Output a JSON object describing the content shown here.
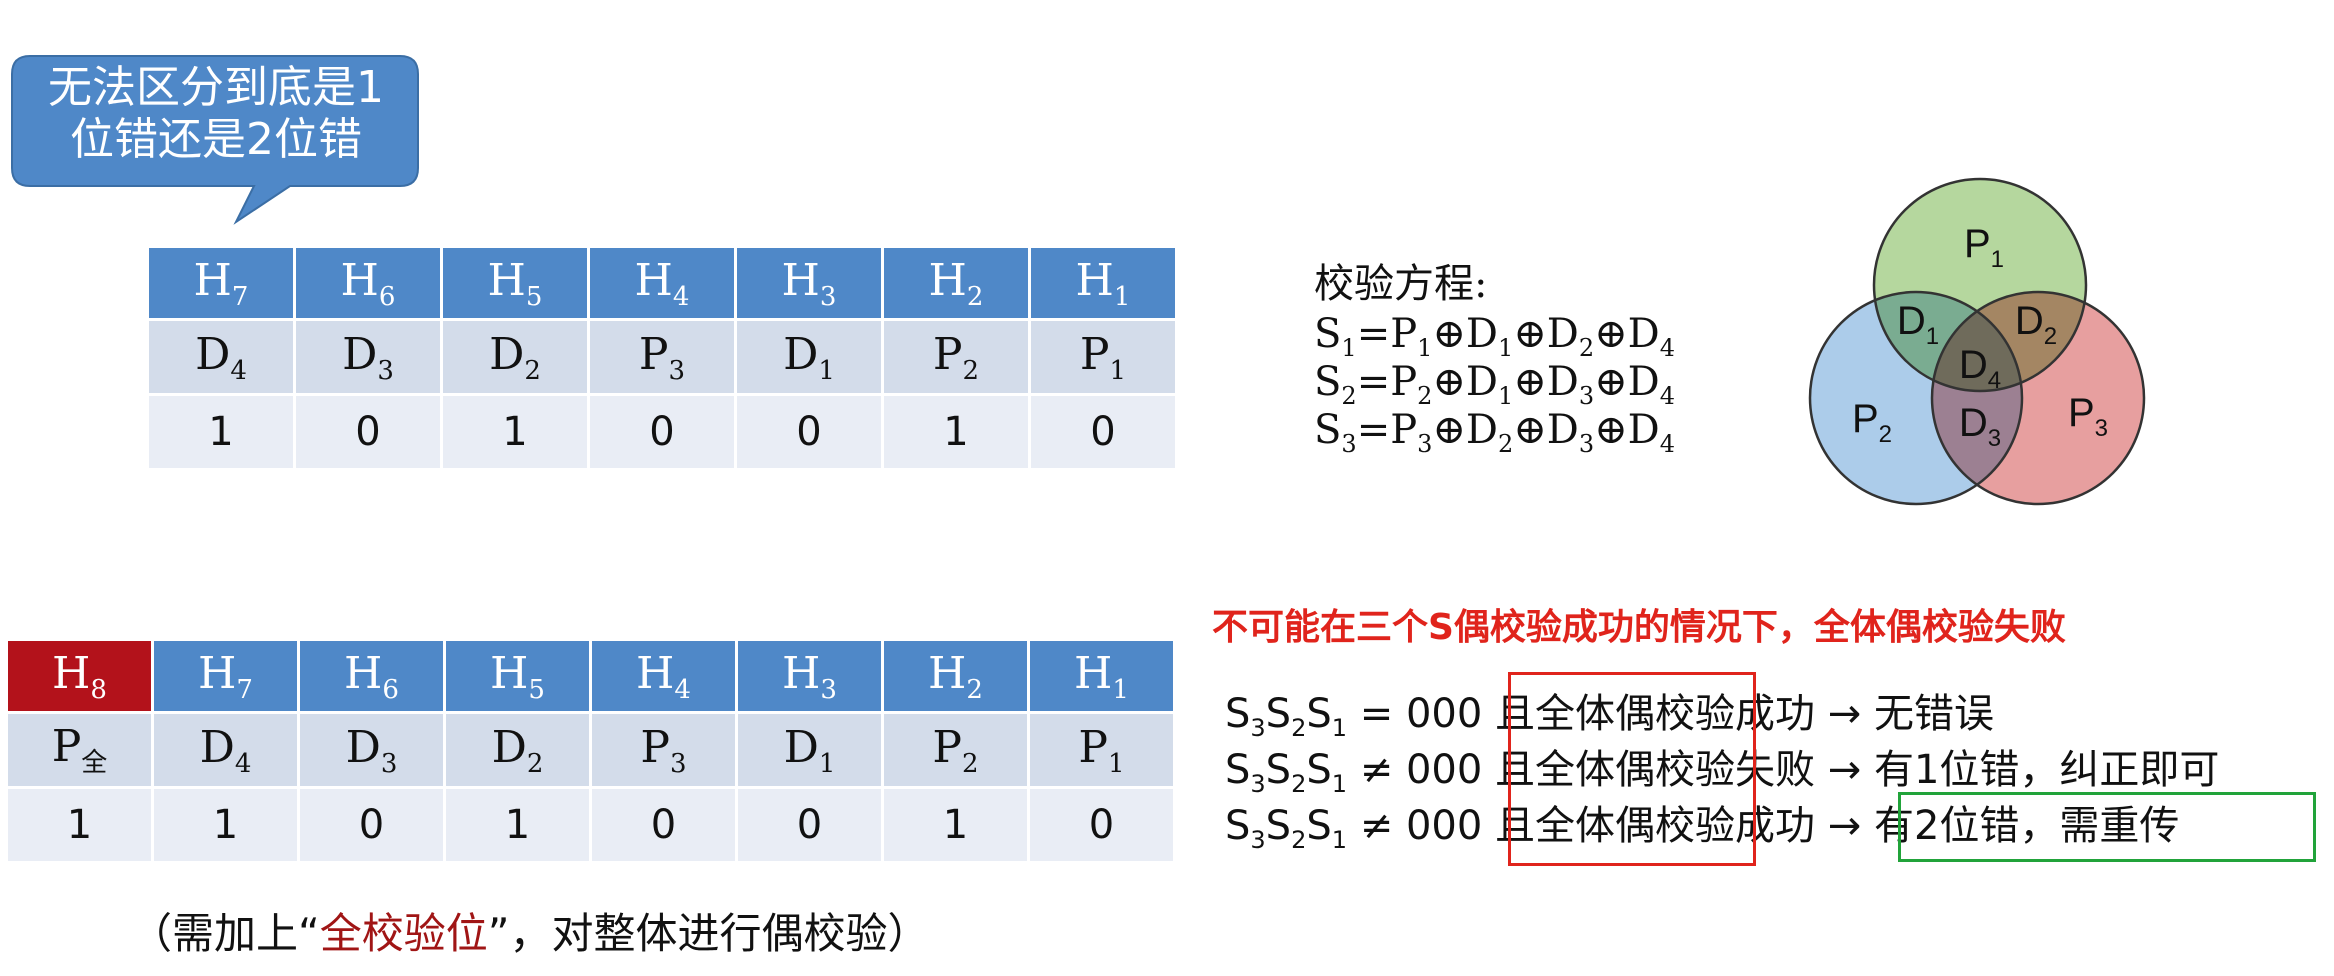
{
  "callout": {
    "line1": "无法区分到底是1",
    "line2": "位错还是2位错"
  },
  "table1": {
    "headers": [
      {
        "base": "H",
        "sub": "7"
      },
      {
        "base": "H",
        "sub": "6"
      },
      {
        "base": "H",
        "sub": "5"
      },
      {
        "base": "H",
        "sub": "4"
      },
      {
        "base": "H",
        "sub": "3"
      },
      {
        "base": "H",
        "sub": "2"
      },
      {
        "base": "H",
        "sub": "1"
      }
    ],
    "labels": [
      {
        "base": "D",
        "sub": "4"
      },
      {
        "base": "D",
        "sub": "3"
      },
      {
        "base": "D",
        "sub": "2"
      },
      {
        "base": "P",
        "sub": "3"
      },
      {
        "base": "D",
        "sub": "1"
      },
      {
        "base": "P",
        "sub": "2"
      },
      {
        "base": "P",
        "sub": "1"
      }
    ],
    "values": [
      "1",
      "0",
      "1",
      "0",
      "0",
      "1",
      "0"
    ]
  },
  "equations": {
    "title": "校验方程:",
    "rows": [
      {
        "s": "S",
        "ss": "1",
        "rhs": [
          [
            "P",
            "1"
          ],
          [
            "D",
            "1"
          ],
          [
            "D",
            "2"
          ],
          [
            "D",
            "4"
          ]
        ]
      },
      {
        "s": "S",
        "ss": "2",
        "rhs": [
          [
            "P",
            "2"
          ],
          [
            "D",
            "1"
          ],
          [
            "D",
            "3"
          ],
          [
            "D",
            "4"
          ]
        ]
      },
      {
        "s": "S",
        "ss": "3",
        "rhs": [
          [
            "P",
            "3"
          ],
          [
            "D",
            "2"
          ],
          [
            "D",
            "3"
          ],
          [
            "D",
            "4"
          ]
        ]
      }
    ],
    "eq": "=",
    "op": "⊕"
  },
  "venn": {
    "p1": {
      "base": "P",
      "sub": "1"
    },
    "p2": {
      "base": "P",
      "sub": "2"
    },
    "p3": {
      "base": "P",
      "sub": "3"
    },
    "d1": {
      "base": "D",
      "sub": "1"
    },
    "d2": {
      "base": "D",
      "sub": "2"
    },
    "d3": {
      "base": "D",
      "sub": "3"
    },
    "d4": {
      "base": "D",
      "sub": "4"
    },
    "colors": {
      "p1": "#a8d08d",
      "p2": "#9dc3e6",
      "p3": "#e38e8e",
      "stroke": "#333333"
    }
  },
  "warning": "不可能在三个S偶校验成功的情况下，全体偶校验失败",
  "table2": {
    "headers": [
      {
        "base": "H",
        "sub": "8"
      },
      {
        "base": "H",
        "sub": "7"
      },
      {
        "base": "H",
        "sub": "6"
      },
      {
        "base": "H",
        "sub": "5"
      },
      {
        "base": "H",
        "sub": "4"
      },
      {
        "base": "H",
        "sub": "3"
      },
      {
        "base": "H",
        "sub": "2"
      },
      {
        "base": "H",
        "sub": "1"
      }
    ],
    "labels": [
      {
        "base": "P",
        "sub": "全"
      },
      {
        "base": "D",
        "sub": "4"
      },
      {
        "base": "D",
        "sub": "3"
      },
      {
        "base": "D",
        "sub": "2"
      },
      {
        "base": "P",
        "sub": "3"
      },
      {
        "base": "D",
        "sub": "1"
      },
      {
        "base": "P",
        "sub": "2"
      },
      {
        "base": "P",
        "sub": "1"
      }
    ],
    "values": [
      "1",
      "1",
      "0",
      "1",
      "0",
      "0",
      "1",
      "0"
    ]
  },
  "conditions": {
    "syndrome": {
      "s3": "3",
      "s2": "2",
      "s1": "1",
      "letter": "S"
    },
    "rows": [
      {
        "rel": "= 000 且",
        "check": "全体偶校验",
        "result": "成功",
        "arrow": "→",
        "outcome": "无错误"
      },
      {
        "rel": "≠ 000 且",
        "check": "全体偶校验",
        "result": "失败",
        "arrow": "→",
        "outcome": "有1位错，纠正即可"
      },
      {
        "rel": "≠ 000 且",
        "check": "全体偶校验",
        "result": "成功",
        "arrow": "→",
        "outcome": "有2位错，需重传"
      }
    ],
    "box_colors": {
      "red": "#e0241c",
      "green": "#21a33a"
    }
  },
  "note": {
    "pre": "（需加上“",
    "highlight": "全校验位",
    "post": "”，对整体进行偶校验）"
  }
}
